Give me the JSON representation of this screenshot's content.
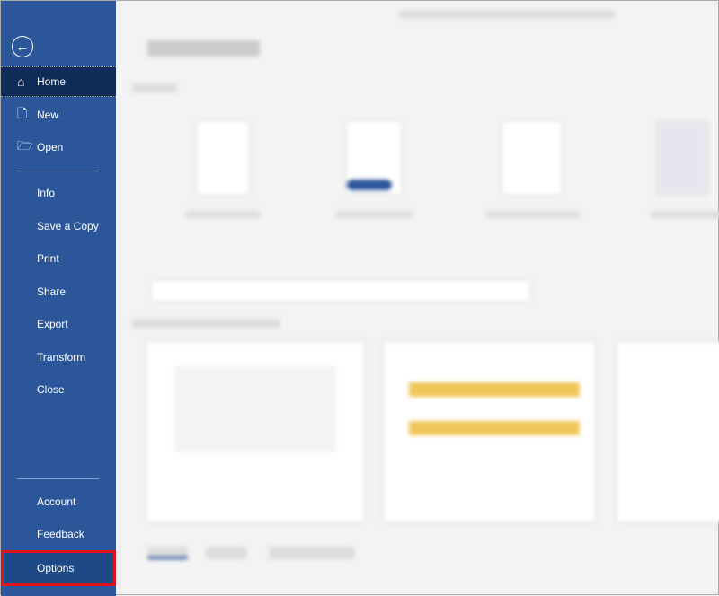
{
  "sidebar": {
    "back_icon": "arrow-left-circle-icon",
    "items": [
      {
        "label": "Home",
        "icon": "home-icon"
      },
      {
        "label": "New",
        "icon": "document-icon"
      },
      {
        "label": "Open",
        "icon": "folder-open-icon"
      },
      {
        "label": "Info"
      },
      {
        "label": "Save a Copy"
      },
      {
        "label": "Print"
      },
      {
        "label": "Share"
      },
      {
        "label": "Export"
      },
      {
        "label": "Transform"
      },
      {
        "label": "Close"
      },
      {
        "label": "Account"
      },
      {
        "label": "Feedback"
      },
      {
        "label": "Options"
      }
    ]
  },
  "colors": {
    "sidebar": "#2b579a",
    "active": "#0f2b57",
    "highlight_border": "#e0101e"
  }
}
